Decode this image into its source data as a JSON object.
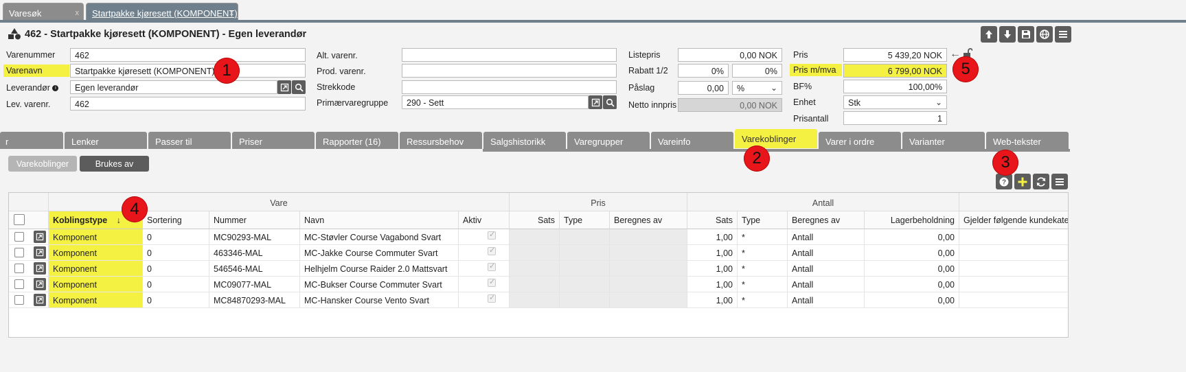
{
  "window_tabs": [
    {
      "label": "Varesøk",
      "close": "x"
    },
    {
      "label": "Startpakke kjøresett (KOMPONENT)",
      "close": "x"
    }
  ],
  "header": {
    "title": "462 - Startpakke kjøresett (KOMPONENT) - Egen leverandør"
  },
  "form": {
    "varenummer_label": "Varenummer",
    "varenummer": "462",
    "varenavn_label": "Varenavn",
    "varenavn": "Startpakke kjøresett (KOMPONENT)",
    "leverandor_label": "Leverandør",
    "leverandor": "Egen leverandør",
    "lev_varenr_label": "Lev. varenr.",
    "lev_varenr": "462",
    "alt_varenr_label": "Alt. varenr.",
    "alt_varenr": "",
    "prod_varenr_label": "Prod. varenr.",
    "prod_varenr": "",
    "strekkode_label": "Strekkode",
    "strekkode": "",
    "primaervaregruppe_label": "Primærvaregruppe",
    "primaervaregruppe": "290 - Sett",
    "listepris_label": "Listepris",
    "listepris": "0,00 NOK",
    "rabatt_label": "Rabatt 1/2",
    "rabatt1": "0%",
    "rabatt2": "0%",
    "paslag_label": "Påslag",
    "paslag": "0,00",
    "paslag_unit": "%",
    "netto_label": "Netto innpris",
    "netto": "0,00 NOK",
    "pris_label": "Pris",
    "pris": "5 439,20 NOK",
    "pris_mva_label": "Pris m/mva",
    "pris_mva": "6 799,00 NOK",
    "bf_label": "BF%",
    "bf": "100,00%",
    "enhet_label": "Enhet",
    "enhet": "Stk",
    "prisantall_label": "Prisantall",
    "prisantall": "1"
  },
  "badges": [
    "1",
    "2",
    "3",
    "4",
    "5"
  ],
  "tabs": [
    {
      "label": "r"
    },
    {
      "label": "Lenker"
    },
    {
      "label": "Passer til"
    },
    {
      "label": "Priser"
    },
    {
      "label": "Rapporter (16)"
    },
    {
      "label": "Ressursbehov"
    },
    {
      "label": "Salgshistorikk"
    },
    {
      "label": "Varegrupper"
    },
    {
      "label": "Vareinfo"
    },
    {
      "label": "Varekoblinger"
    },
    {
      "label": "Varer i ordre"
    },
    {
      "label": "Varianter"
    },
    {
      "label": "Web-tekster"
    }
  ],
  "subtabs": {
    "varekoblinger": "Varekoblinger",
    "brukes_av": "Brukes av"
  },
  "grid": {
    "groups": {
      "vare": "Vare",
      "pris": "Pris",
      "antall": "Antall"
    },
    "columns": {
      "koblingstype": "Koblingstype",
      "sort_arrow": "↓",
      "sortering": "Sortering",
      "nummer": "Nummer",
      "navn": "Navn",
      "aktiv": "Aktiv",
      "pris_sats": "Sats",
      "pris_type": "Type",
      "pris_beregnes": "Beregnes av",
      "ant_sats": "Sats",
      "ant_type": "Type",
      "ant_beregnes": "Beregnes av",
      "lager": "Lagerbeholdning",
      "gjelder": "Gjelder følgende kundekateg"
    },
    "rows": [
      {
        "koblingstype": "Komponent",
        "sortering": "0",
        "nummer": "MC90293-MAL",
        "navn": "MC-Støvler Course Vagabond Svart",
        "ant_sats": "1,00",
        "ant_type": "*",
        "ant_beregnes": "Antall",
        "lager": "0,00"
      },
      {
        "koblingstype": "Komponent",
        "sortering": "0",
        "nummer": "463346-MAL",
        "navn": "MC-Jakke Course Commuter Svart",
        "ant_sats": "1,00",
        "ant_type": "*",
        "ant_beregnes": "Antall",
        "lager": "0,00"
      },
      {
        "koblingstype": "Komponent",
        "sortering": "0",
        "nummer": "546546-MAL",
        "navn": "Helhjelm Course Raider 2.0 Mattsvart",
        "ant_sats": "1,00",
        "ant_type": "*",
        "ant_beregnes": "Antall",
        "lager": "0,00"
      },
      {
        "koblingstype": "Komponent",
        "sortering": "0",
        "nummer": "MC09077-MAL",
        "navn": "MC-Bukser Course Commuter Svart",
        "ant_sats": "1,00",
        "ant_type": "*",
        "ant_beregnes": "Antall",
        "lager": "0,00"
      },
      {
        "koblingstype": "Komponent",
        "sortering": "0",
        "nummer": "MC84870293-MAL",
        "navn": "MC-Hansker Course Vento Svart",
        "ant_sats": "1,00",
        "ant_type": "*",
        "ant_beregnes": "Antall",
        "lager": "0,00"
      }
    ]
  },
  "colors": {
    "highlight": "#f4f142",
    "badge": "#e8151b",
    "tab": "#8c8c8c",
    "button": "#5c5c5c",
    "active_window_tab": "#6f7f8c"
  }
}
